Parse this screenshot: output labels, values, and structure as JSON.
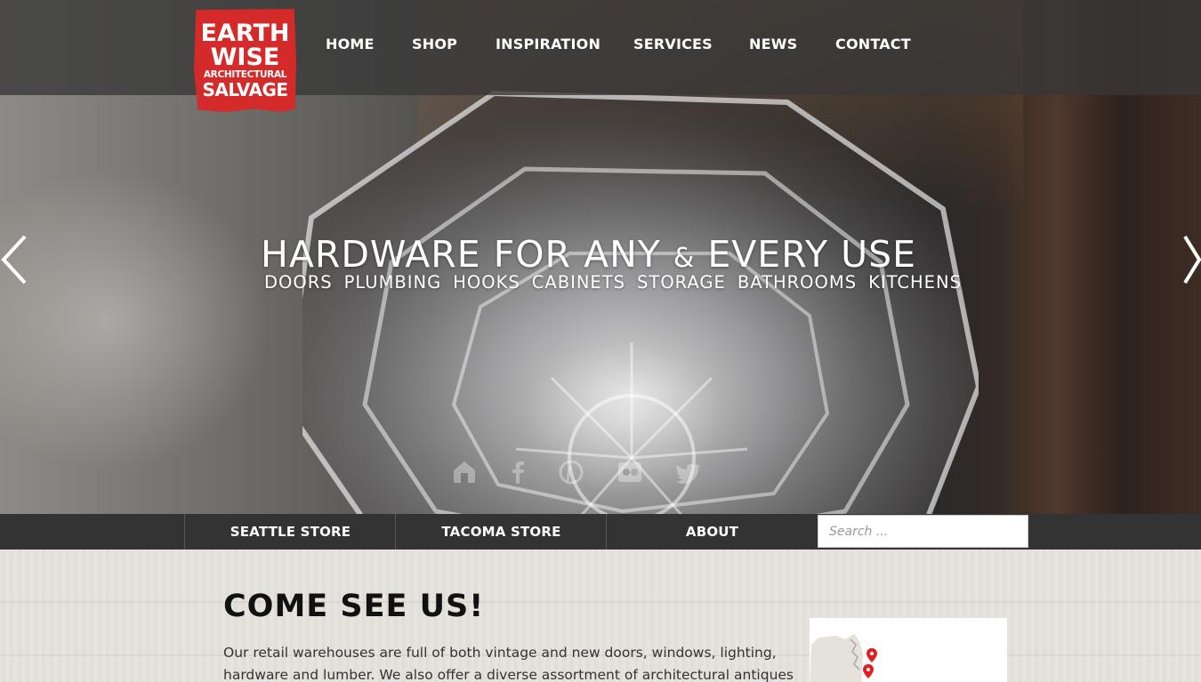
{
  "logo": {
    "line1": "EARTH",
    "line2": "WISE",
    "line3": "ARCHITECTURAL",
    "line4": "SALVAGE",
    "color": "#d42a2a"
  },
  "nav": {
    "items": [
      {
        "label": "HOME"
      },
      {
        "label": "SHOP"
      },
      {
        "label": "INSPIRATION"
      },
      {
        "label": "SERVICES"
      },
      {
        "label": "NEWS"
      },
      {
        "label": "CONTACT"
      }
    ]
  },
  "hero": {
    "title_part1": "HARDWARE FOR ANY ",
    "title_amp": "&",
    "title_part2": " EVERY USE",
    "subtitle": [
      "DOORS",
      "PLUMBING",
      "HOOKS",
      "CABINETS",
      "STORAGE",
      "BATHROOMS",
      "KITCHENS"
    ],
    "prev_icon": "chevron-left-icon",
    "next_icon": "chevron-right-icon",
    "social_icons": [
      "houzz-icon",
      "facebook-icon",
      "pinterest-icon",
      "flickr-icon",
      "twitter-icon"
    ]
  },
  "subnav": {
    "items": [
      {
        "label": "SEATTLE STORE"
      },
      {
        "label": "TACOMA STORE"
      },
      {
        "label": "ABOUT"
      }
    ],
    "search_placeholder": "Search ..."
  },
  "content": {
    "heading": "COME SEE US!",
    "body": "Our retail warehouses are full of both vintage and new doors, windows, lighting, hardware and lumber. We also offer a diverse assortment of architectural antiques including stained",
    "map_pin_color": "#e02020"
  }
}
